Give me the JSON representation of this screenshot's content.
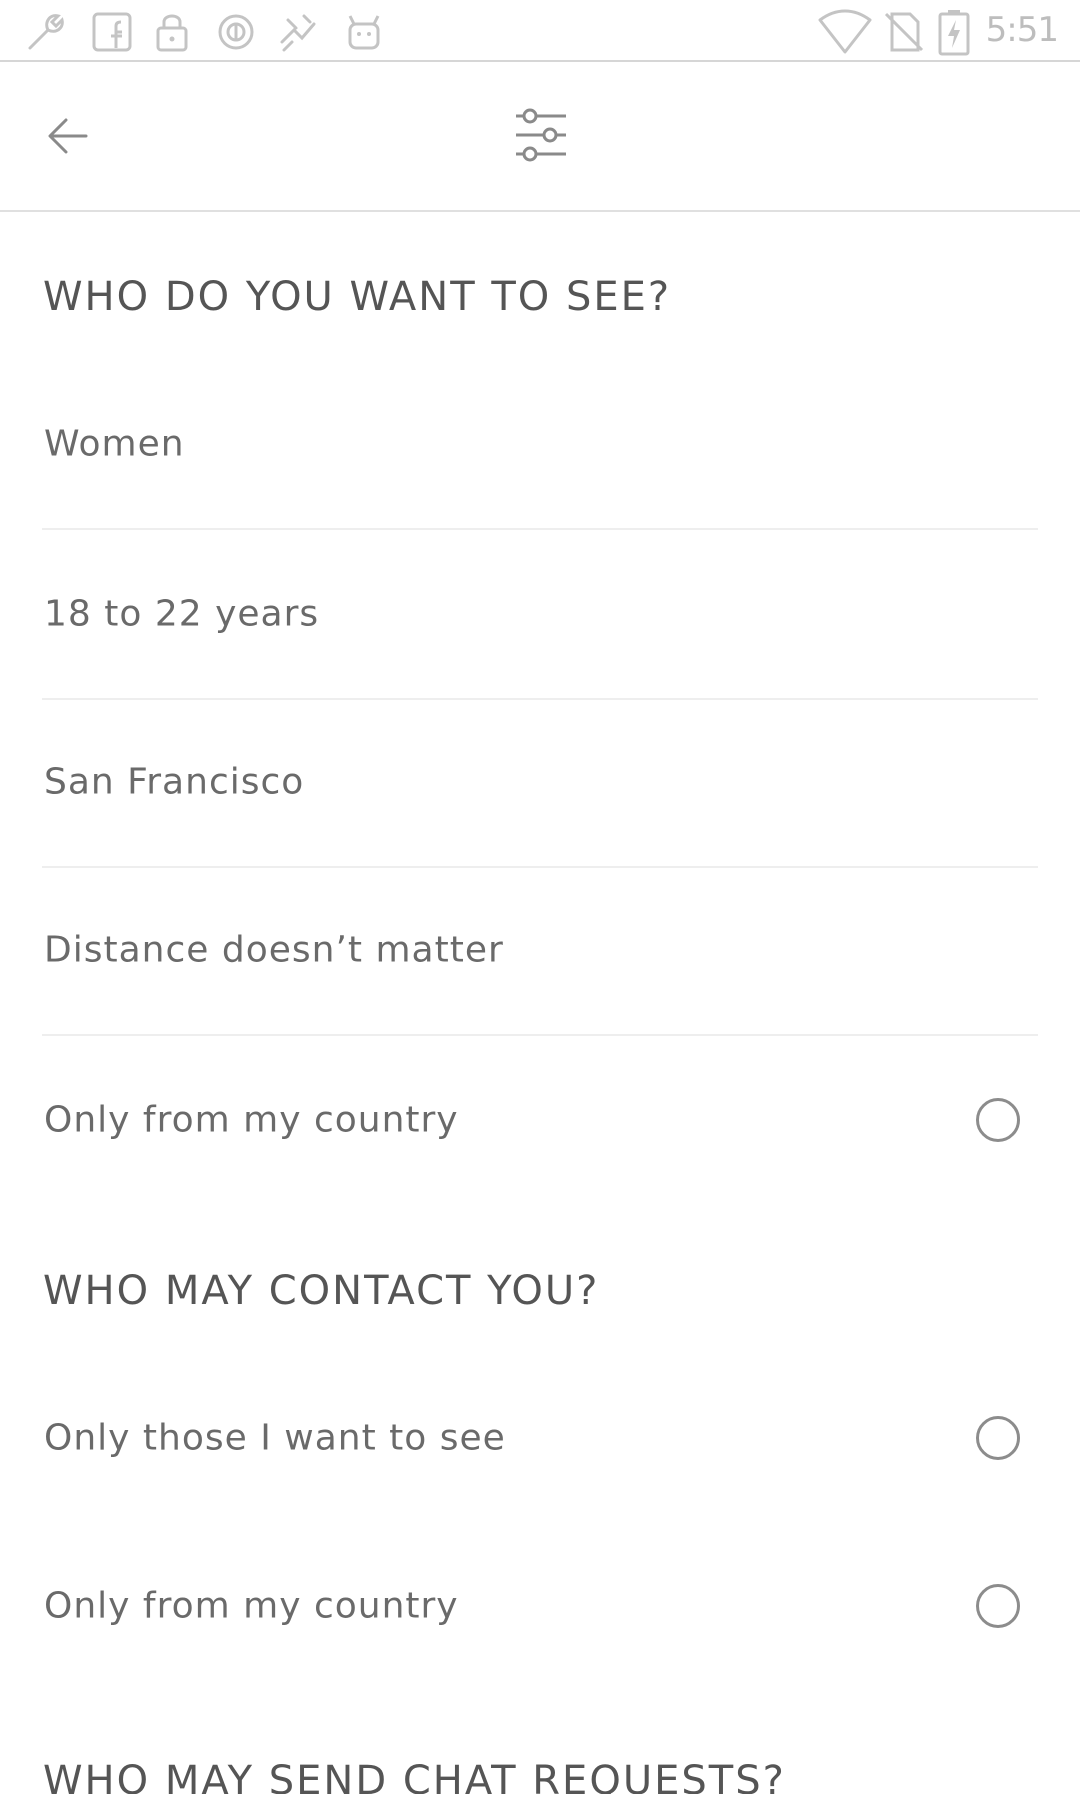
{
  "status_bar": {
    "time": "5:51",
    "left_icons": [
      "wrench-icon",
      "facebook-icon",
      "lock-icon",
      "circle-badge-icon",
      "app-icon",
      "android-icon"
    ],
    "right_icons": [
      "wifi-icon",
      "no-sim-icon",
      "battery-charging-icon"
    ]
  },
  "toolbar": {
    "back_icon": "back-arrow-icon",
    "filter_icon": "sliders-icon"
  },
  "sections": {
    "see": {
      "title": "WHO DO YOU WANT TO SEE?",
      "gender": "Women",
      "age_range": "18 to 22 years",
      "location": "San Francisco",
      "distance": "Distance doesn’t matter",
      "only_country_label": "Only from my country",
      "only_country_checked": false
    },
    "contact": {
      "title": "WHO MAY CONTACT YOU?",
      "only_wanted_label": "Only those I want to see",
      "only_wanted_checked": false,
      "only_country_label": "Only from my country",
      "only_country_checked": false
    },
    "chat": {
      "title": "WHO MAY SEND CHAT REQUESTS?"
    }
  },
  "colors": {
    "text": "#555555",
    "divider": "#eeeeee",
    "radio_border": "#8c8c8c"
  }
}
